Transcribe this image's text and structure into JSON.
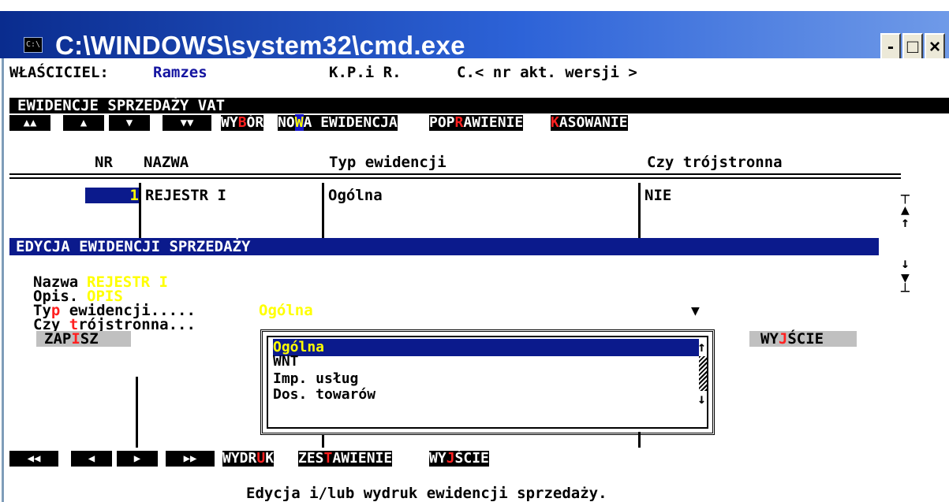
{
  "window": {
    "title": "C:\\WINDOWS\\system32\\cmd.exe",
    "icon_label": "C:\\",
    "minimize_label": "-",
    "maximize_label": "□",
    "close_label": "×"
  },
  "header": {
    "owner_label": "WŁAŚCICIEL:",
    "owner_value": "Ramzes",
    "app_name": "K.P.i R.",
    "version": "C.< nr akt. wersji >"
  },
  "section_title": "EWIDENCJE SPRZEDAŻY VAT",
  "top_nav": {
    "buttons": [
      "▲▲",
      "▲",
      "▼",
      "▼▼"
    ],
    "menu": [
      {
        "pre": "WY",
        "hot": "B",
        "post": "ÓR",
        "hot_style": "red"
      },
      {
        "pre": "NO",
        "hot": "W",
        "post": "A EWIDENCJA",
        "hot_style": "box"
      },
      {
        "pre": "POP",
        "hot": "R",
        "post": "AWIENIE",
        "hot_style": "red"
      },
      {
        "pre": "",
        "hot": "K",
        "post": "ASOWANIE",
        "hot_style": "red"
      }
    ]
  },
  "table": {
    "headers": [
      "NR",
      "NAZWA",
      "Typ ewidencji",
      "Czy trójstronna"
    ],
    "rows": [
      {
        "nr": "1",
        "nazwa": "REJESTR I",
        "typ": "Ogólna",
        "trojstronna": "NIE"
      }
    ]
  },
  "edit_panel": {
    "title": "EDYCJA EWIDENCJI SPRZEDAŻY",
    "nazwa_label": "Nazwa",
    "nazwa_value": "REJESTR I",
    "opis_label": "Opis.",
    "opis_value": "OPIS",
    "typ_label_pre": "Ty",
    "typ_label_hot": "p",
    "typ_label_post": " ewidencji.....",
    "typ_value": "Ogólna",
    "czy_label_pre": "Czy ",
    "czy_label_hot": "t",
    "czy_label_post": "rójstronna...",
    "save": {
      "pre": "ZAP",
      "hot": "I",
      "post": "SZ"
    },
    "exit": {
      "pre": "WY",
      "hot": "J",
      "post": "ŚCIE"
    }
  },
  "dropdown": {
    "options": [
      "Ogólna",
      "WNT",
      "Imp. usług",
      "Dos. towarów"
    ],
    "selected_index": 0
  },
  "bottom_nav": {
    "buttons": [
      "◀◀",
      "◀",
      "▶",
      "▶▶"
    ],
    "menu": [
      {
        "pre": "WYDR",
        "hot": "U",
        "post": "K"
      },
      {
        "pre": "ZES",
        "hot": "T",
        "post": "AWIENIE"
      },
      {
        "pre": "WY",
        "hot": "J",
        "post": "ŚCIE"
      }
    ]
  },
  "status_line": "Edycja i/lub wydruk ewidencji sprzedaży."
}
